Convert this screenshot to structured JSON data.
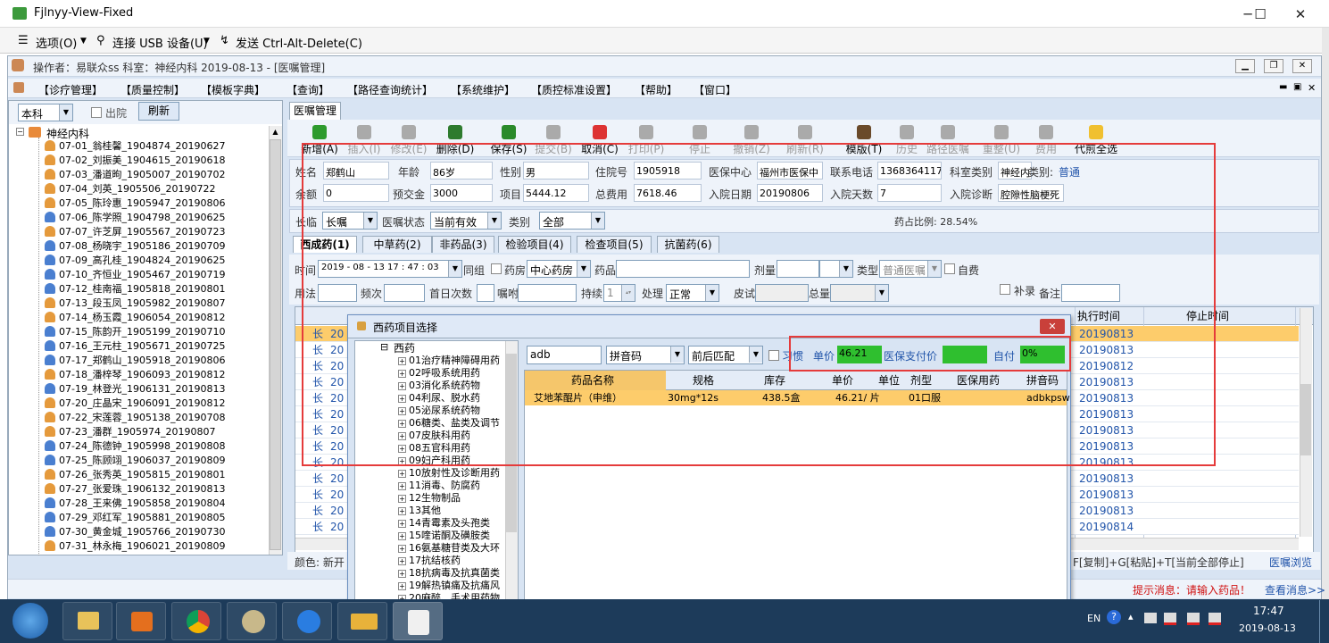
{
  "window": {
    "title": "Fjlnyy-View-Fixed",
    "min": "─",
    "max": "☐",
    "close": "✕"
  },
  "remote_menu": {
    "options": "选项(O)",
    "usb": "连接 USB 设备(U)",
    "send": "发送 Ctrl-Alt-Delete(C)"
  },
  "opbar": {
    "text": "操作者：易联众ss   科室：神经内科   2019-08-13 - [医嘱管理]"
  },
  "menu": [
    "【诊疗管理】",
    "【质量控制】",
    "【模板字典】",
    "【查询】",
    "【路径查询统计】",
    "【系统维护】",
    "【质控标准设置】",
    "【帮助】",
    "【窗口】"
  ],
  "left": {
    "dept_select": "本科",
    "discharged_label": "出院",
    "refresh": "刷新",
    "root": "神经内科",
    "patients": [
      {
        "t": "07-01_翁桂馨_1904874_20190627",
        "g": "f"
      },
      {
        "t": "07-02_刘振美_1904615_20190618",
        "g": "f"
      },
      {
        "t": "07-03_潘道昫_1905007_20190702",
        "g": "f"
      },
      {
        "t": "07-04_刘英_1905506_20190722",
        "g": "f"
      },
      {
        "t": "07-05_陈玲惠_1905947_20190806",
        "g": "f"
      },
      {
        "t": "07-06_陈学照_1904798_20190625",
        "g": "m"
      },
      {
        "t": "07-07_许芝屏_1905567_20190723",
        "g": "f"
      },
      {
        "t": "07-08_杨晓宇_1905186_20190709",
        "g": "m"
      },
      {
        "t": "07-09_高孔桂_1904824_20190625",
        "g": "m"
      },
      {
        "t": "07-10_齐恒业_1905467_20190719",
        "g": "m"
      },
      {
        "t": "07-12_桂南福_1905818_20190801",
        "g": "m"
      },
      {
        "t": "07-13_段玉凤_1905982_20190807",
        "g": "f"
      },
      {
        "t": "07-14_杨玉霞_1906054_20190812",
        "g": "f"
      },
      {
        "t": "07-15_陈韵开_1905199_20190710",
        "g": "m"
      },
      {
        "t": "07-16_王元柱_1905671_20190725",
        "g": "m"
      },
      {
        "t": "07-17_郑鹤山_1905918_20190806",
        "g": "m"
      },
      {
        "t": "07-18_潘梓琴_1906093_20190812",
        "g": "f"
      },
      {
        "t": "07-19_林登光_1906131_20190813",
        "g": "m"
      },
      {
        "t": "07-20_庄晶宋_1906091_20190812",
        "g": "f"
      },
      {
        "t": "07-22_宋莲蓉_1905138_20190708",
        "g": "f"
      },
      {
        "t": "07-23_潘群_1905974_20190807",
        "g": "f"
      },
      {
        "t": "07-24_陈德钟_1905998_20190808",
        "g": "m"
      },
      {
        "t": "07-25_陈顾翊_1906037_20190809",
        "g": "m"
      },
      {
        "t": "07-26_张秀英_1905815_20190801",
        "g": "f"
      },
      {
        "t": "07-27_张爱珠_1906132_20190813",
        "g": "f"
      },
      {
        "t": "07-28_王来佛_1905858_20190804",
        "g": "m"
      },
      {
        "t": "07-29_邓红军_1905881_20190805",
        "g": "m"
      },
      {
        "t": "07-30_黄金城_1905766_20190730",
        "g": "m"
      },
      {
        "t": "07-31_林永梅_1906021_20190809",
        "g": "f"
      }
    ]
  },
  "tab": "医嘱管理",
  "toolbar": [
    {
      "label": "新增(A)",
      "color": "#2e9b2e",
      "dis": false
    },
    {
      "label": "插入(I)",
      "color": "#aaa",
      "dis": true
    },
    {
      "label": "修改(E)",
      "color": "#aaa",
      "dis": true
    },
    {
      "label": "删除(D)",
      "color": "#2e7b2e",
      "dis": false
    },
    {
      "label": "保存(S)",
      "color": "#2a8a2a",
      "dis": false
    },
    {
      "label": "提交(B)",
      "color": "#aaa",
      "dis": true
    },
    {
      "label": "取消(C)",
      "color": "#d33",
      "dis": false
    },
    {
      "label": "打印(P)",
      "color": "#aaa",
      "dis": true
    },
    {
      "label": "停止",
      "color": "#aaa",
      "dis": true
    },
    {
      "label": "撤销(Z)",
      "color": "#aaa",
      "dis": true
    },
    {
      "label": "刷新(R)",
      "color": "#aaa",
      "dis": true
    },
    {
      "label": "模版(T)",
      "color": "#6a4a2a",
      "dis": false
    },
    {
      "label": "历史",
      "color": "#aaa",
      "dis": true
    },
    {
      "label": "路径医嘱",
      "color": "#aaa",
      "dis": true
    },
    {
      "label": "重整(U)",
      "color": "#aaa",
      "dis": true
    },
    {
      "label": "费用",
      "color": "#aaa",
      "dis": true
    },
    {
      "label": "代煎全选",
      "color": "#f0c030",
      "dis": false
    }
  ],
  "patient": {
    "name_l": "姓名",
    "name": "郑鹤山",
    "age_l": "年龄",
    "age": "86岁",
    "sex_l": "性别",
    "sex": "男",
    "inno_l": "住院号",
    "inno": "1905918",
    "ins_l": "医保中心",
    "ins": "福州市医保中",
    "phone_l": "联系电话",
    "phone": "13683641179",
    "dept_l": "科室类别",
    "dept": "神经内科",
    "type_l": "类别:",
    "type": "普通",
    "bal_l": "余额",
    "bal": "0",
    "pre_l": "预交金",
    "pre": "3000",
    "item_l": "项目",
    "item": "5444.12",
    "total_l": "总费用",
    "total": "7618.46",
    "indate_l": "入院日期",
    "indate": "20190806",
    "days_l": "入院天数",
    "days": "7",
    "diag_l": "入院诊断",
    "diag": "腔隙性脑梗死"
  },
  "row3": {
    "long_l": "长临",
    "long": "长嘱",
    "state_l": "医嘱状态",
    "state": "当前有效",
    "cat_l": "类别",
    "cat": "全部",
    "ratio": "药占比例: 28.54%"
  },
  "subtabs": [
    "西成药(1)",
    "中草药(2)",
    "非药品(3)",
    "检验项目(4)",
    "检查项目(5)",
    "抗菌药(6)"
  ],
  "form": {
    "time_l": "时间",
    "time": "2019 - 08 - 13 17 : 47 : 03",
    "group": "同组",
    "pharm_l": "药房",
    "pharm": "中心药房",
    "drug_l": "药品",
    "dose_l": "剂量",
    "kind_l": "类型",
    "kind": "普通医嘱",
    "self": "自费",
    "usage_l": "用法",
    "freq_l": "频次",
    "first_l": "首日次数",
    "inst_l": "嘱咐",
    "dur_l": "持续",
    "dur": "1",
    "proc_l": "处理",
    "proc": "正常",
    "skin_l": "皮试",
    "qty_l": "总量",
    "supp": "补录",
    "note_l": "备注"
  },
  "grid": {
    "h_exec": "执行时间",
    "h_stop": "停止时间",
    "rows": [
      {
        "k": "长",
        "y": "20",
        "d": "20190813"
      },
      {
        "k": "长",
        "y": "20",
        "d": "20190813"
      },
      {
        "k": "长",
        "y": "20",
        "d": "20190812"
      },
      {
        "k": "长",
        "y": "20",
        "d": "20190813"
      },
      {
        "k": "长",
        "y": "20",
        "d": "20190813"
      },
      {
        "k": "长",
        "y": "20",
        "d": "20190813"
      },
      {
        "k": "长",
        "y": "20",
        "d": "20190813"
      },
      {
        "k": "长",
        "y": "20",
        "d": "20190813"
      },
      {
        "k": "长",
        "y": "20",
        "d": "20190813"
      },
      {
        "k": "长",
        "y": "20",
        "d": "20190813"
      },
      {
        "k": "长",
        "y": "20",
        "d": "20190813"
      },
      {
        "k": "长",
        "y": "20",
        "d": "20190813"
      },
      {
        "k": "长",
        "y": "20",
        "d": "20190814"
      }
    ],
    "color_l": "颜色: 新开",
    "hint": "F[复制]+G[粘贴]+T[当前全部停止]",
    "browse": "医嘱浏览"
  },
  "bottom": {
    "msg": "提示消息：请输入药品！",
    "more": "查看消息>>"
  },
  "dialog": {
    "title": "西药项目选择",
    "close": "✕",
    "root": "西药",
    "cats": [
      "01治疗精神障碍用药",
      "02呼吸系统用药",
      "03消化系统药物",
      "04利尿、脱水药",
      "05泌尿系统药物",
      "06糖类、盐类及调节",
      "07皮肤科用药",
      "08五官科用药",
      "09妇产科用药",
      "10放射性及诊断用药",
      "11消毒、防腐药",
      "12生物制品",
      "13其他",
      "14青霉素及头孢类",
      "15喹诺酮及磺胺类",
      "16氨基糖苷类及大环",
      "17抗结核药",
      "18抗病毒及抗真菌类",
      "19解热镇痛及抗痛风",
      "20麻醉、手术用药物"
    ],
    "search": "adb",
    "mode": "拼音码",
    "match": "前后匹配",
    "habit": "习惯",
    "price_l": "单价",
    "price": "46.21",
    "ins_l": "医保支付价",
    "self_l": "自付",
    "self": "0%",
    "headers": [
      "药品名称",
      "规格",
      "库存",
      "单价",
      "单位",
      "剂型",
      "医保用药",
      "拼音码"
    ],
    "row": [
      "艾地苯醌片（申维）",
      "30mg*12s",
      "438.5盒",
      "46.21/ 片",
      "",
      "01口服",
      "",
      "adbkpsw"
    ]
  },
  "taskbar": {
    "lang": "EN",
    "time": "17:47",
    "date": "2019-08-13"
  }
}
